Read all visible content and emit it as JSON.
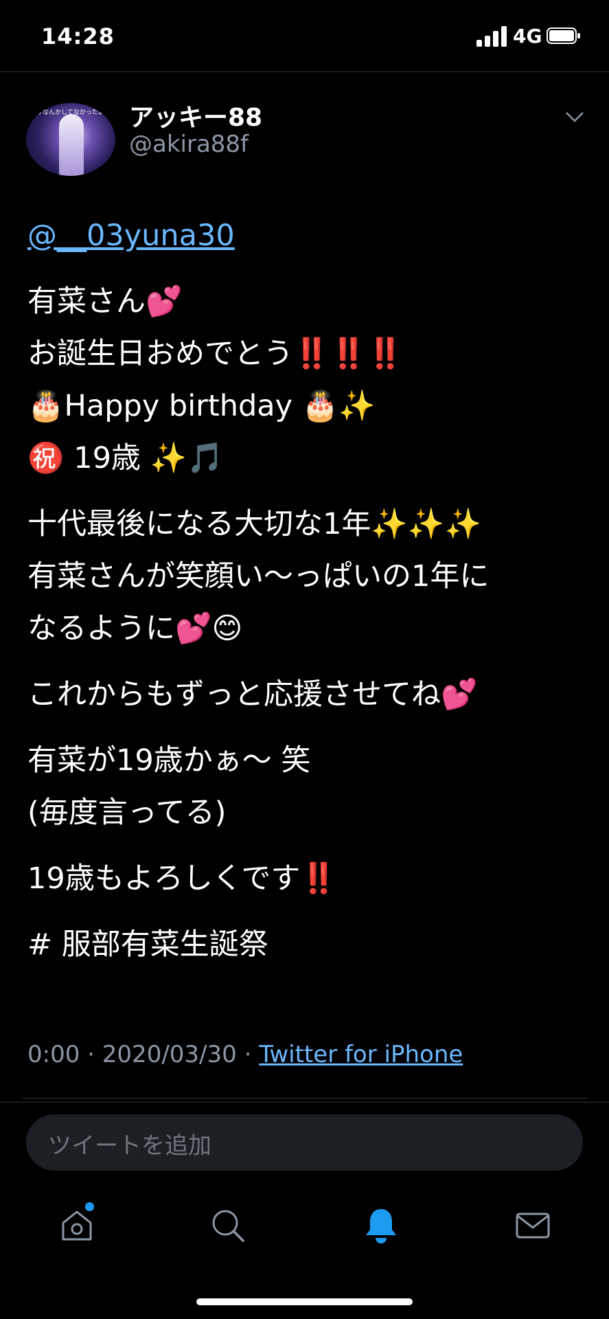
{
  "status_bar": {
    "time": "14:28",
    "network": "4G"
  },
  "tweet": {
    "display_name": "アッキー88",
    "handle": "@akira88f",
    "avatar_caption": "とりなんかしてなかったよね？",
    "mention": "@__03yuna30",
    "lines": {
      "l1": "有菜さん💕",
      "l2": "お誕生日おめでとう‼️‼️‼️",
      "l3": "🎂Happy birthday 🎂✨",
      "l4": "㊗️ 19歳 ✨🎵",
      "l5": "十代最後になる大切な1年✨✨✨",
      "l6": "有菜さんが笑顔い〜っぱいの1年に",
      "l7": "なるように💕😊",
      "l8": "これからもずっと応援させてね💕",
      "l9": "有菜が19歳かぁ〜 笑",
      "l10": "(毎度言ってる)",
      "l11": "19歳もよろしくです‼️",
      "l12": "# 服部有菜生誕祭"
    },
    "meta": {
      "time": "0:00",
      "date": "2020/03/30",
      "separator": " · ",
      "source": "Twitter for iPhone"
    }
  },
  "reply": {
    "placeholder": "ツイートを追加"
  },
  "tabbar": {
    "active_color": "#1d9bf0",
    "inactive_color": "#8b98a5",
    "home_icon": "home-icon",
    "search_icon": "search-icon",
    "notifications_icon": "bell-icon",
    "messages_icon": "envelope-icon"
  }
}
